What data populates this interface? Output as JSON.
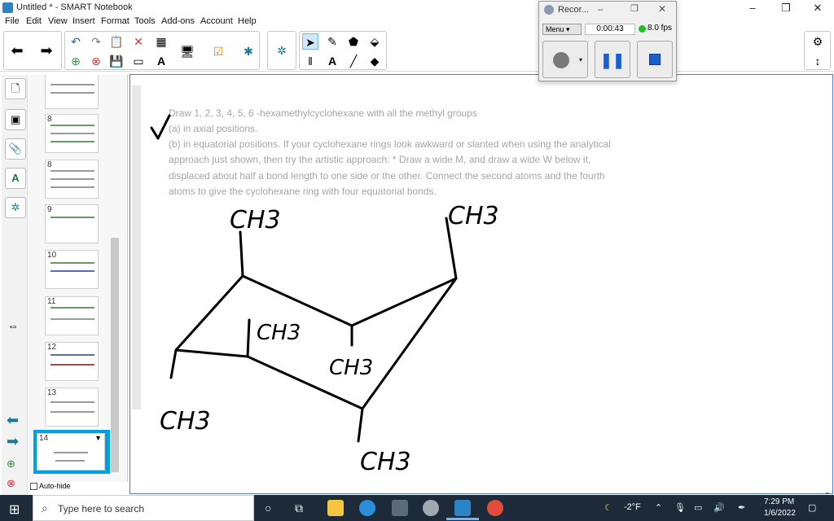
{
  "window": {
    "title": "Untitled * - SMART Notebook"
  },
  "menu": [
    "File",
    "Edit",
    "View",
    "Insert",
    "Format",
    "Tools",
    "Add-ons",
    "Account",
    "Help"
  ],
  "recorder": {
    "title": "Recor...",
    "menu_label": "Menu",
    "time": "0:00:43",
    "fps": "8.0 fps"
  },
  "pages": [
    {
      "num": ""
    },
    {
      "num": "8"
    },
    {
      "num": "8"
    },
    {
      "num": "9"
    },
    {
      "num": "10"
    },
    {
      "num": "11"
    },
    {
      "num": "12"
    },
    {
      "num": "13"
    },
    {
      "num": "14"
    }
  ],
  "sidebar": {
    "autohide_label": "Auto-hide"
  },
  "question": {
    "line1": "Draw 1, 2, 3, 4, 5, 6 -hexamethylcyclohexane with all the methyl groups",
    "line2": "(a) in axial positions.",
    "line3": "(b) in equatorial positions. If your cyclohexane rings look awkward or slanted when using the analytical",
    "line4": "approach just shown, then try the artistic approach: * Draw a wide M, and draw a wide W below it,",
    "line5": "displaced about half a bond length to one side or the other. Connect the second atoms and the fourth",
    "line6": "atoms to give the cyclohexane ring with four equatorial bonds."
  },
  "handwriting": [
    "CH3",
    "CH3",
    "CH3",
    "CH3",
    "CH3",
    "CH3"
  ],
  "taskbar": {
    "search_placeholder": "Type here to search",
    "weather": "-2°F",
    "time": "7:29 PM",
    "date": "1/6/2022"
  },
  "colors": {
    "accent": "#2a84c6",
    "taskbar": "#1c2a3a",
    "selection": "#00a0e3"
  }
}
